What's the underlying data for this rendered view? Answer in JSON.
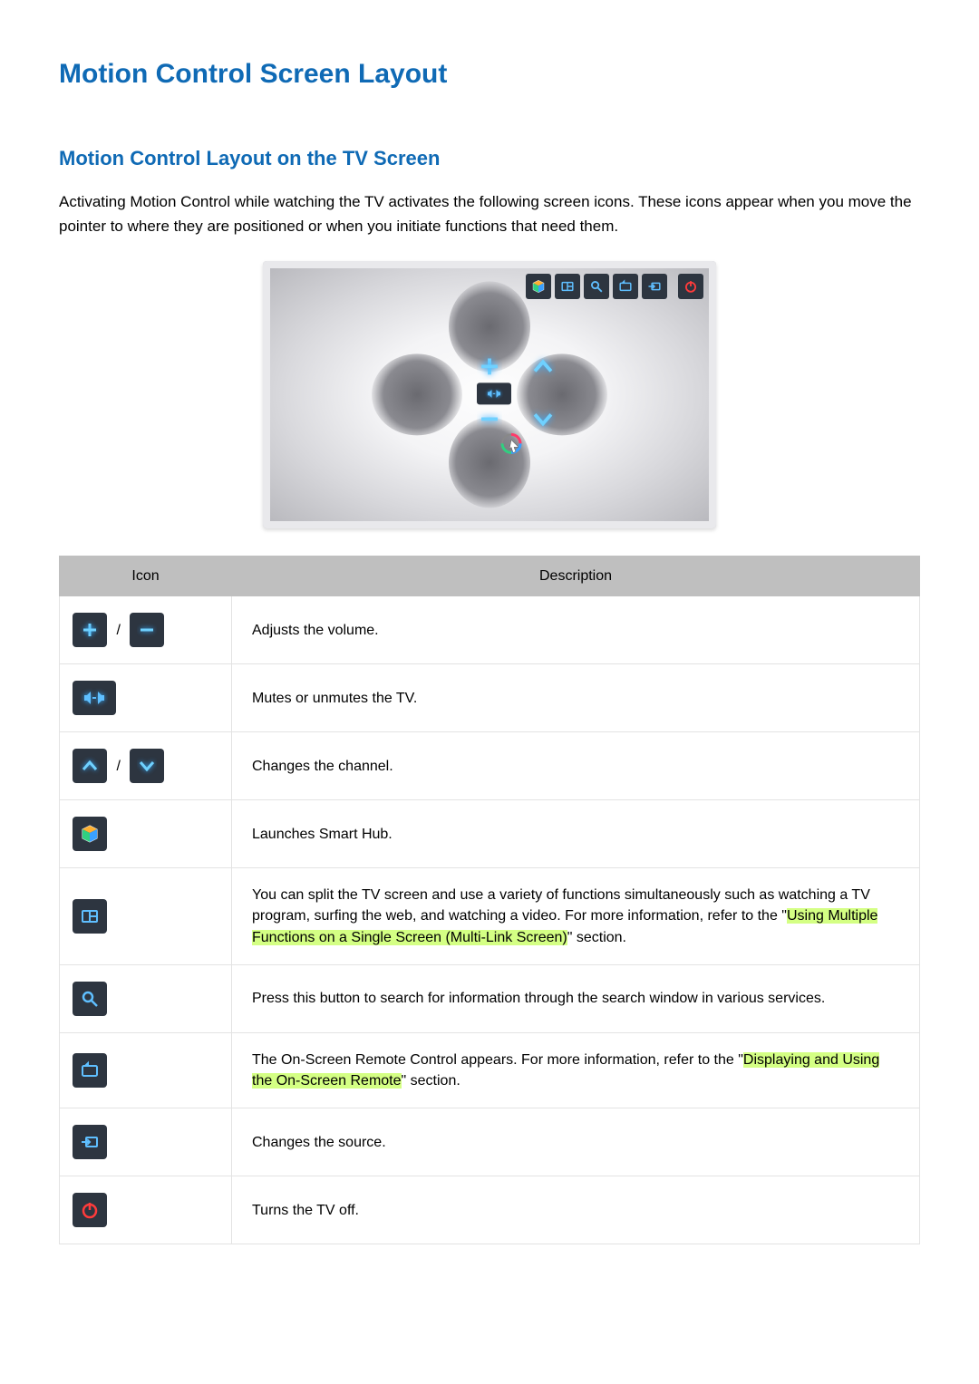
{
  "title": "Motion Control Screen Layout",
  "subtitle": "Motion Control Layout on the TV Screen",
  "intro": "Activating Motion Control while watching the TV activates the following screen icons. These icons appear when you move the pointer to where they are positioned or when you initiate functions that need them.",
  "table": {
    "header": {
      "icon": "Icon",
      "desc": "Description"
    },
    "rows": [
      {
        "id": "volume",
        "icons": [
          "plus-icon",
          "minus-icon"
        ],
        "sep": "/",
        "desc": "Adjusts the volume."
      },
      {
        "id": "mute",
        "icons": [
          "mute-icon"
        ],
        "desc": "Mutes or unmutes the TV."
      },
      {
        "id": "channel",
        "icons": [
          "chevron-up-icon",
          "chevron-down-icon"
        ],
        "sep": "/",
        "desc": "Changes the channel."
      },
      {
        "id": "smarthub",
        "icons": [
          "smarthub-icon"
        ],
        "desc": "Launches Smart Hub."
      },
      {
        "id": "multilink",
        "icons": [
          "multilink-icon"
        ],
        "desc_pre": "You can split the TV screen and use a variety of functions simultaneously such as watching a TV program, surfing the web, and watching a video. For more information, refer to the \"",
        "desc_hl": "Using Multiple Functions on a Single Screen (Multi-Link Screen)",
        "desc_post": "\" section."
      },
      {
        "id": "search",
        "icons": [
          "search-icon"
        ],
        "desc": "Press this button to search for information through the search window in various services."
      },
      {
        "id": "osremote",
        "icons": [
          "remote-icon"
        ],
        "desc_pre": "The On-Screen Remote Control appears. For more information, refer to the \"",
        "desc_hl": "Displaying and Using the On-Screen Remote",
        "desc_post": "\" section."
      },
      {
        "id": "source",
        "icons": [
          "source-icon"
        ],
        "desc": "Changes the source."
      },
      {
        "id": "power",
        "icons": [
          "power-icon"
        ],
        "desc": "Turns the TV off."
      }
    ]
  }
}
